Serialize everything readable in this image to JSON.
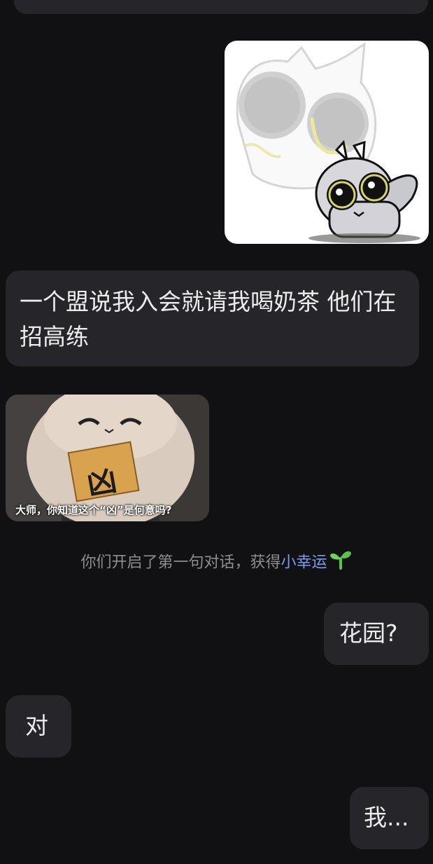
{
  "messages": [
    {
      "side": "left",
      "type": "text",
      "text": "一个盟说我入会就请我喝奶茶 他们在招高练"
    },
    {
      "side": "left",
      "type": "sticker",
      "caption": "大师，你知道这个“凶”是何意吗?",
      "sign_text": "凶"
    },
    {
      "side": "right",
      "type": "text",
      "text": "花园?"
    },
    {
      "side": "left",
      "type": "text",
      "text": "对"
    },
    {
      "side": "right",
      "type": "text",
      "text": "我..."
    }
  ],
  "system": {
    "prefix": "你们开启了第一句对话，获得",
    "highlight": "小幸运",
    "icon": "sprout-icon"
  },
  "colors": {
    "background": "#111113",
    "bubble": "#26262a",
    "text": "#ececee",
    "system_text": "#8d8d92",
    "highlight": "#7d9cf0",
    "sprout": "#5cc24a"
  }
}
